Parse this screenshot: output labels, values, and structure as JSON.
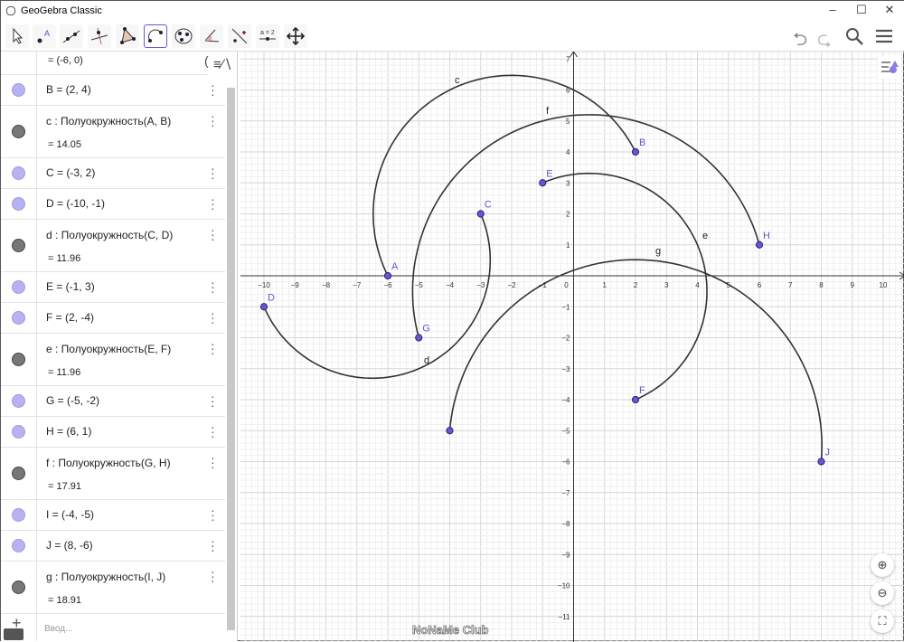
{
  "window": {
    "title": "GeoGebra Classic",
    "minimize": "–",
    "maximize": "☐",
    "close": "✕"
  },
  "toolbar": {
    "tools": [
      "move",
      "point",
      "line",
      "perpendicular",
      "polygon",
      "semicircle",
      "circle",
      "angle",
      "reflect",
      "slider",
      "move-graphics"
    ],
    "selected": "semicircle",
    "slider_label": "a = 2"
  },
  "algebra": {
    "rows": [
      {
        "kind": "point",
        "text": "",
        "value": "=  (-6, 0)",
        "partial": true
      },
      {
        "kind": "point",
        "text": "B = (2, 4)"
      },
      {
        "kind": "curve",
        "text": "c : Полуокружность(A, B)",
        "value": "=  14.05"
      },
      {
        "kind": "point",
        "text": "C = (-3, 2)"
      },
      {
        "kind": "point",
        "text": "D = (-10, -1)"
      },
      {
        "kind": "curve",
        "text": "d : Полуокружность(C, D)",
        "value": "=  11.96"
      },
      {
        "kind": "point",
        "text": "E = (-1, 3)"
      },
      {
        "kind": "point",
        "text": "F = (2, -4)"
      },
      {
        "kind": "curve",
        "text": "e : Полуокружность(E, F)",
        "value": "=  11.96"
      },
      {
        "kind": "point",
        "text": "G = (-5, -2)"
      },
      {
        "kind": "point",
        "text": "H = (6, 1)"
      },
      {
        "kind": "curve",
        "text": "f : Полуокружность(G, H)",
        "value": "=  17.91"
      },
      {
        "kind": "point",
        "text": "I = (-4, -5)"
      },
      {
        "kind": "point",
        "text": "J = (8, -6)"
      },
      {
        "kind": "curve",
        "text": "g : Полуокружность(I, J)",
        "value": "=  18.91"
      }
    ],
    "input_placeholder": "Ввод...",
    "partial_char": "("
  },
  "graphics": {
    "points": [
      {
        "name": "A",
        "x": -6,
        "y": 0,
        "show": true
      },
      {
        "name": "B",
        "x": 2,
        "y": 4,
        "show": true
      },
      {
        "name": "C",
        "x": -3,
        "y": 2,
        "show": true
      },
      {
        "name": "D",
        "x": -10,
        "y": -1,
        "show": true
      },
      {
        "name": "E",
        "x": -1,
        "y": 3,
        "show": true
      },
      {
        "name": "F",
        "x": 2,
        "y": -4,
        "show": true
      },
      {
        "name": "G",
        "x": -5,
        "y": -2,
        "show": true
      },
      {
        "name": "H",
        "x": 6,
        "y": 1,
        "show": true
      },
      {
        "name": "I",
        "x": -4,
        "y": -5,
        "show": false
      },
      {
        "name": "J",
        "x": 8,
        "y": -6,
        "show": true
      }
    ],
    "semicircles": [
      {
        "name": "c",
        "from": "A",
        "to": "B"
      },
      {
        "name": "d",
        "from": "C",
        "to": "D"
      },
      {
        "name": "e",
        "from": "E",
        "to": "F"
      },
      {
        "name": "f",
        "from": "G",
        "to": "H"
      },
      {
        "name": "g",
        "from": "I",
        "to": "J"
      }
    ],
    "xrange": [
      -10,
      10
    ],
    "yrange": [
      -11,
      7
    ],
    "point_color": "#6557d2",
    "curve_color": "#333333"
  },
  "watermark": "NoNaMe Club"
}
